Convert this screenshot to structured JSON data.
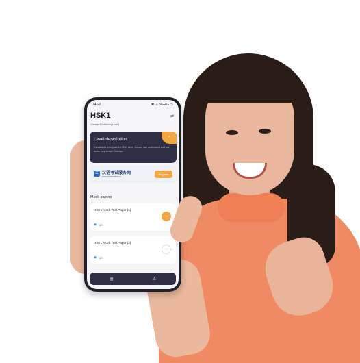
{
  "status_bar": {
    "time": "14:22",
    "icons": "✱ ⊿ 5G 4G ▭"
  },
  "header": {
    "title": "HSK1",
    "subtitle": "Chinese ProficiencyLevel1",
    "swap_icon": "swap-icon"
  },
  "level_card": {
    "title": "Level description",
    "text": "Candidates who pass the HSK Level 1 exam can understand and use some very simple Chinese...",
    "arrow": "›"
  },
  "banner": {
    "name": "汉语考试服务网",
    "url": "www.chinesetest.cn",
    "register_label": "Register"
  },
  "section_title": "Mock papers",
  "mock_papers": [
    {
      "title": "HSK1 Mock Test Paper (1)",
      "gems": "10",
      "arrow": "→"
    },
    {
      "title": "HSK1 Mock Test Paper (2)",
      "gems": "10",
      "arrow": "→"
    }
  ],
  "tabbar": {
    "items": [
      "list-icon",
      "profile-icon"
    ]
  },
  "colors": {
    "accent": "#f2a742",
    "card_dark": "#2f3046",
    "sweater": "#f08a62"
  }
}
